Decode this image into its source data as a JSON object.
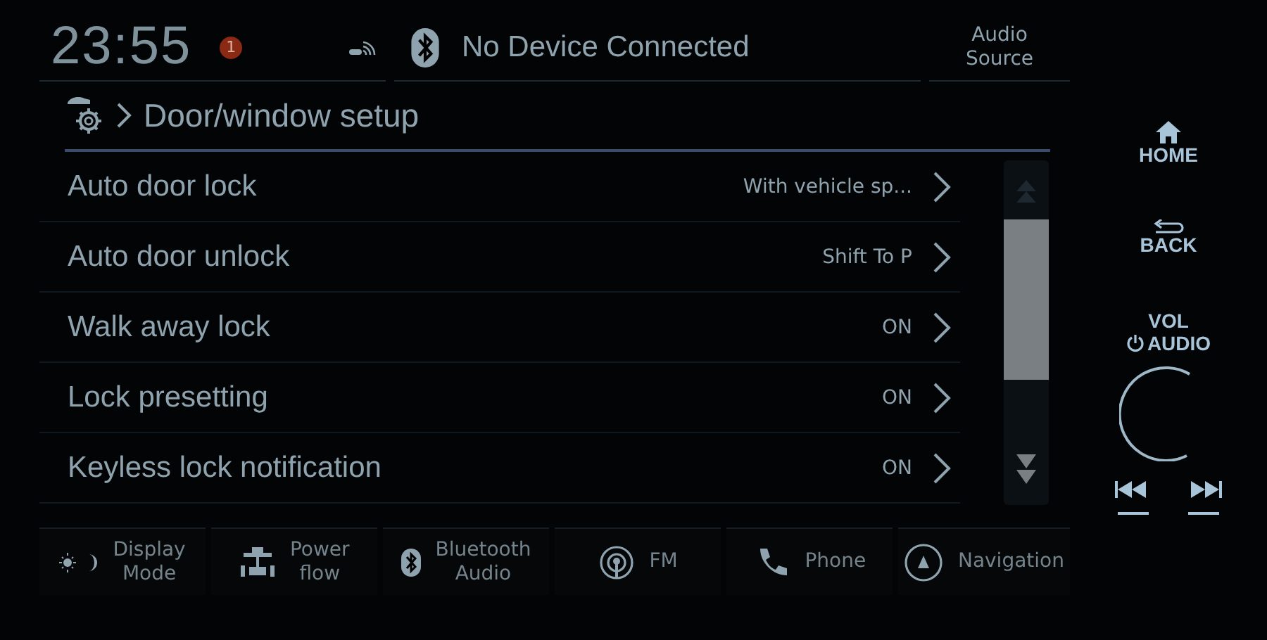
{
  "status_bar": {
    "clock": "23:55",
    "alert_badge": "1",
    "bluetooth_status": "No Device Connected",
    "audio_source_button": "Audio\nSource"
  },
  "header": {
    "title": "Door/window setup"
  },
  "settings": [
    {
      "label": "Auto door lock",
      "value": "With vehicle sp..."
    },
    {
      "label": "Auto door unlock",
      "value": "Shift To P"
    },
    {
      "label": "Walk away lock",
      "value": "ON"
    },
    {
      "label": "Lock presetting",
      "value": "ON"
    },
    {
      "label": "Keyless lock notification",
      "value": "ON"
    }
  ],
  "shortcut_bar": [
    {
      "kind": "display",
      "label": "Display\nMode"
    },
    {
      "kind": "power",
      "label": "Power\nflow"
    },
    {
      "kind": "bluetooth",
      "label": "Bluetooth\nAudio"
    },
    {
      "kind": "radio",
      "label": "FM"
    },
    {
      "kind": "phone",
      "label": "Phone"
    },
    {
      "kind": "navigation",
      "label": "Navigation"
    }
  ],
  "hard_keys": {
    "home": "HOME",
    "back": "BACK",
    "vol_top": "VOL",
    "vol_bottom": "AUDIO"
  }
}
